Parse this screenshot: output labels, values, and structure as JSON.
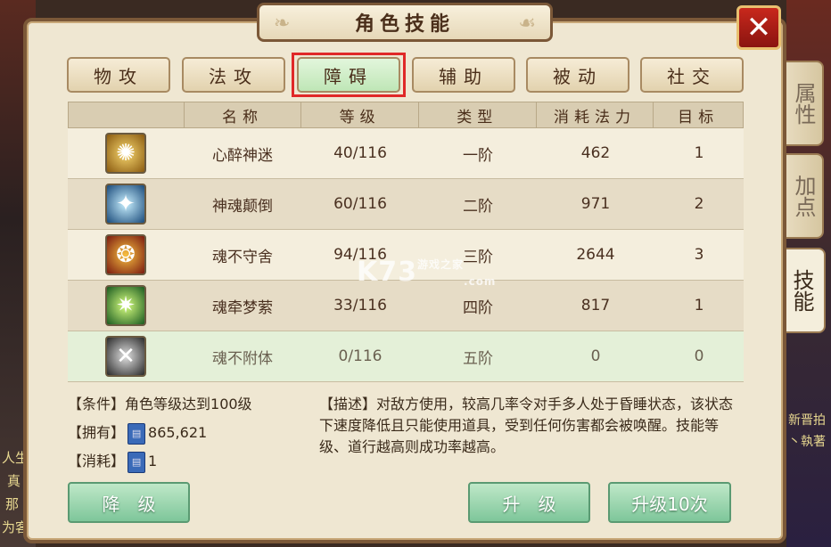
{
  "window": {
    "title": "角色技能",
    "close_label": "✕"
  },
  "category_tabs": [
    {
      "label": "物攻",
      "active": false
    },
    {
      "label": "法攻",
      "active": false
    },
    {
      "label": "障碍",
      "active": true
    },
    {
      "label": "辅助",
      "active": false
    },
    {
      "label": "被动",
      "active": false
    },
    {
      "label": "社交",
      "active": false
    }
  ],
  "side_tabs": [
    {
      "label": "属性",
      "active": false
    },
    {
      "label": "加点",
      "active": false
    },
    {
      "label": "技能",
      "active": true
    }
  ],
  "table": {
    "headers": [
      "",
      "名称",
      "等级",
      "类型",
      "消耗法力",
      "目标"
    ],
    "rows": [
      {
        "icon": "fire-swirl-icon",
        "name": "心醉神迷",
        "level": "40/116",
        "type": "一阶",
        "mana": "462",
        "target": "1"
      },
      {
        "icon": "ice-strike-icon",
        "name": "神魂颠倒",
        "level": "60/116",
        "type": "二阶",
        "mana": "971",
        "target": "2"
      },
      {
        "icon": "phoenix-emblem-icon",
        "name": "魂不守舍",
        "level": "94/116",
        "type": "三阶",
        "mana": "2644",
        "target": "3"
      },
      {
        "icon": "green-sparkle-icon",
        "name": "魂牵梦萦",
        "level": "33/116",
        "type": "四阶",
        "mana": "817",
        "target": "1"
      },
      {
        "icon": "grey-web-icon",
        "name": "魂不附体",
        "level": "0/116",
        "type": "五阶",
        "mana": "0",
        "target": "0"
      }
    ]
  },
  "info": {
    "condition_label": "【条件】",
    "condition_value": "角色等级达到100级",
    "own_label": "【拥有】",
    "own_value": "865,621",
    "cost_label": "【消耗】",
    "cost_value": "1",
    "description": "【描述】对敌方使用，较高几率令对手多人处于昏睡状态，该状态下速度降低且只能使用道具，受到任何伤害都会被唤醒。技能等级、道行越高则成功率越高。"
  },
  "buttons": {
    "downgrade": "降　级",
    "upgrade": "升　级",
    "upgrade10": "升级10次"
  },
  "background": {
    "left_text": [
      "人生",
      "真",
      "那",
      "为客"
    ],
    "right_text": [
      "新晋拍",
      "丶執著"
    ]
  },
  "watermark": {
    "main": "K73",
    "sub": "游戏之家",
    "domain": ".com"
  },
  "colors": {
    "panel_bg": "#efe7d2",
    "frame": "#7b5838",
    "active_tab": "#bfe6b6",
    "highlight_border": "#e02828",
    "button_green": "#7ec69a",
    "close_red": "#c8281c"
  }
}
